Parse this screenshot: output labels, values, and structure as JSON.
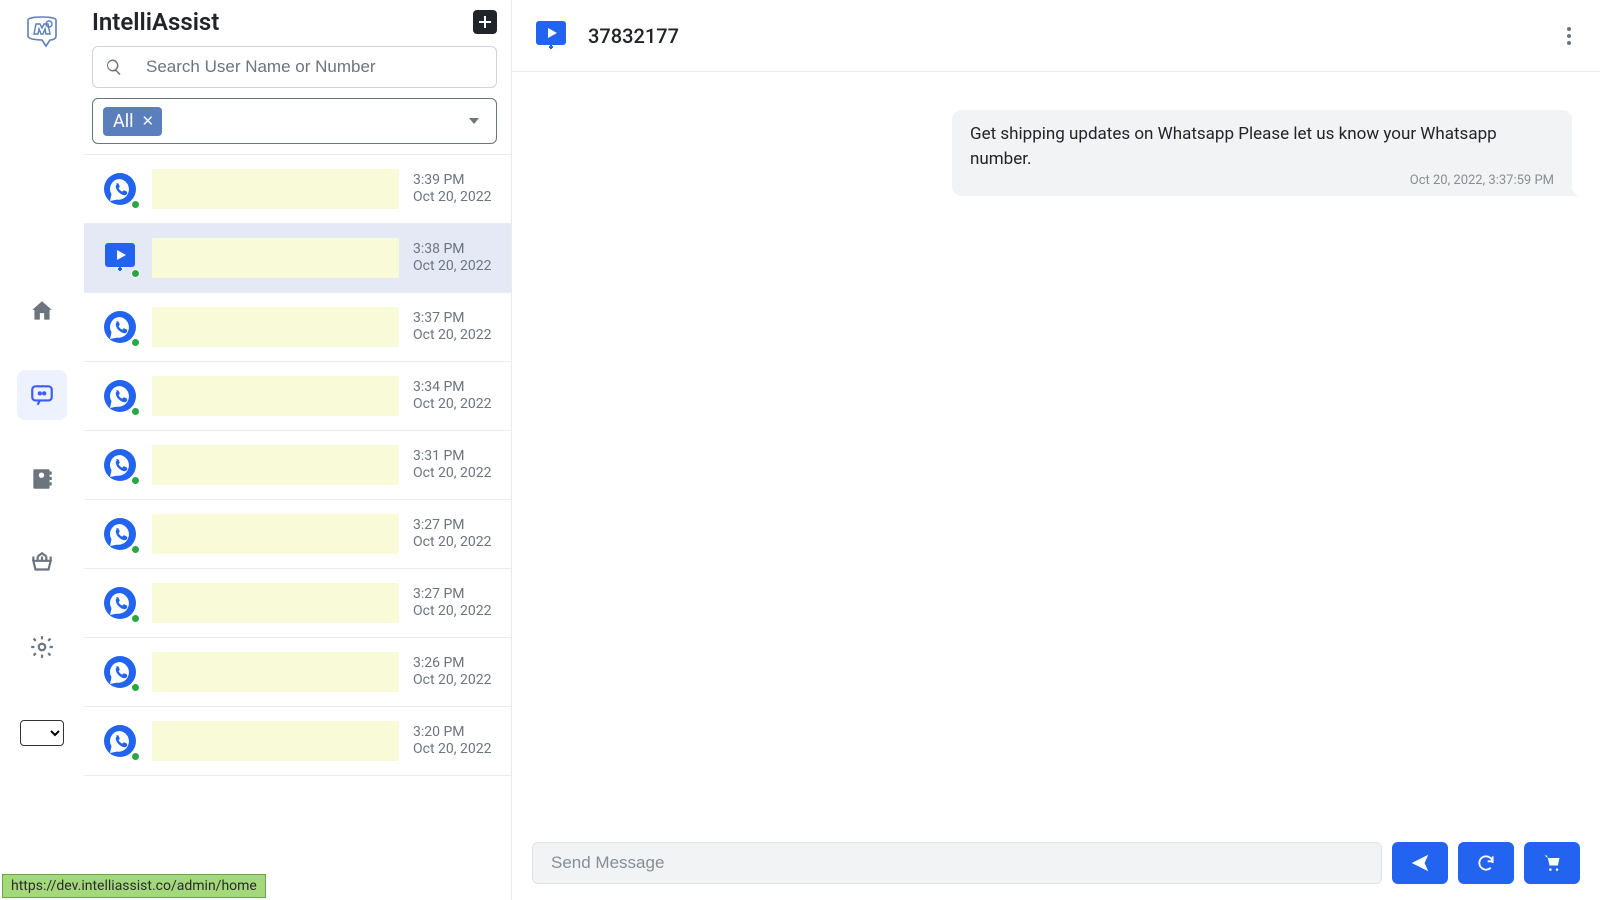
{
  "brand": "IntelliAssist",
  "nav": {
    "items": [
      {
        "name": "home"
      },
      {
        "name": "chat",
        "active": true
      },
      {
        "name": "contacts"
      },
      {
        "name": "orders"
      },
      {
        "name": "settings"
      }
    ]
  },
  "search": {
    "placeholder": "Search User Name or Number"
  },
  "filter": {
    "chip_label": "All"
  },
  "conversations": [
    {
      "channel": "whatsapp",
      "time": "3:39 PM",
      "date": "Oct 20, 2022",
      "selected": false
    },
    {
      "channel": "web",
      "time": "3:38 PM",
      "date": "Oct 20, 2022",
      "selected": true
    },
    {
      "channel": "whatsapp",
      "time": "3:37 PM",
      "date": "Oct 20, 2022",
      "selected": false
    },
    {
      "channel": "whatsapp",
      "time": "3:34 PM",
      "date": "Oct 20, 2022",
      "selected": false
    },
    {
      "channel": "whatsapp",
      "time": "3:31 PM",
      "date": "Oct 20, 2022",
      "selected": false
    },
    {
      "channel": "whatsapp",
      "time": "3:27 PM",
      "date": "Oct 20, 2022",
      "selected": false
    },
    {
      "channel": "whatsapp",
      "time": "3:27 PM",
      "date": "Oct 20, 2022",
      "selected": false
    },
    {
      "channel": "whatsapp",
      "time": "3:26 PM",
      "date": "Oct 20, 2022",
      "selected": false
    },
    {
      "channel": "whatsapp",
      "time": "3:20 PM",
      "date": "Oct 20, 2022",
      "selected": false
    }
  ],
  "chat": {
    "header_id": "37832177",
    "messages": [
      {
        "direction": "outgoing",
        "text": "Get shipping updates on Whatsapp Please let us know your Whatsapp number.",
        "timestamp": "Oct 20, 2022, 3:37:59 PM"
      }
    ],
    "compose_placeholder": "Send Message"
  },
  "status_tooltip": "https://dev.intelliassist.co/admin/home"
}
